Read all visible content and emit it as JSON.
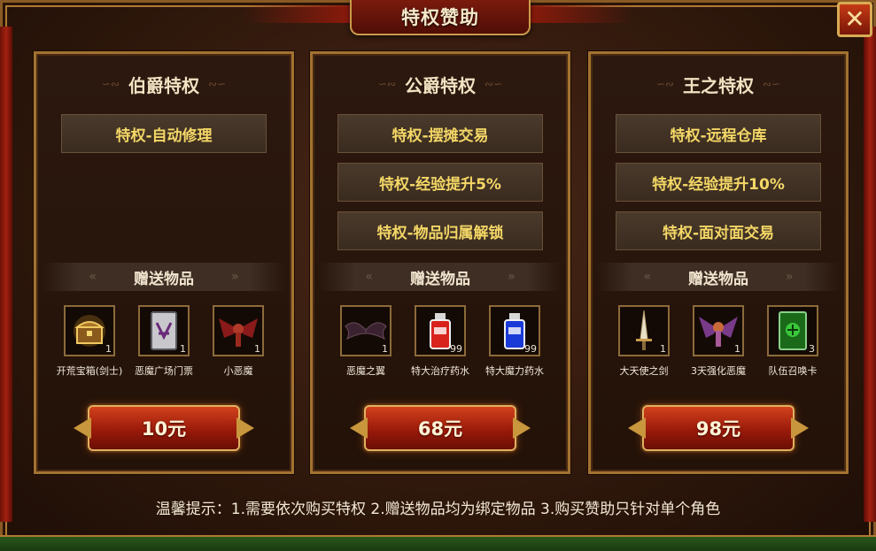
{
  "title": "特权赞助",
  "close_icon": "close-x-icon",
  "panels": [
    {
      "title": "伯爵特权",
      "privileges": [
        "特权-自动修理"
      ],
      "gift_label": "赠送物品",
      "items": [
        {
          "name": "开荒宝箱(剑士)",
          "count": "1",
          "icon": "treasure-chest-icon"
        },
        {
          "name": "恶魔广场门票",
          "count": "1",
          "icon": "ticket-card-icon"
        },
        {
          "name": "小恶魔",
          "count": "1",
          "icon": "imp-pet-icon"
        }
      ],
      "price": "10元"
    },
    {
      "title": "公爵特权",
      "privileges": [
        "特权-摆摊交易",
        "特权-经验提升5%",
        "特权-物品归属解锁"
      ],
      "gift_label": "赠送物品",
      "items": [
        {
          "name": "恶魔之翼",
          "count": "1",
          "icon": "demon-wings-icon"
        },
        {
          "name": "特大治疗药水",
          "count": "99",
          "icon": "red-potion-icon"
        },
        {
          "name": "特大魔力药水",
          "count": "99",
          "icon": "blue-potion-icon"
        }
      ],
      "price": "68元"
    },
    {
      "title": "王之特权",
      "privileges": [
        "特权-远程仓库",
        "特权-经验提升10%",
        "特权-面对面交易"
      ],
      "gift_label": "赠送物品",
      "items": [
        {
          "name": "大天使之剑",
          "count": "1",
          "icon": "sword-icon"
        },
        {
          "name": "3天强化恶魔",
          "count": "1",
          "icon": "demon-pet-icon"
        },
        {
          "name": "队伍召唤卡",
          "count": "3",
          "icon": "summon-card-icon"
        }
      ],
      "price": "98元"
    }
  ],
  "tip": "温馨提示：1.需要依次购买特权 2.赠送物品均为绑定物品 3.购买赞助只针对单个角色",
  "colors": {
    "privilege_text": "#f4d766",
    "button_red": "#9a1a0a",
    "frame_gold": "#a27230"
  }
}
